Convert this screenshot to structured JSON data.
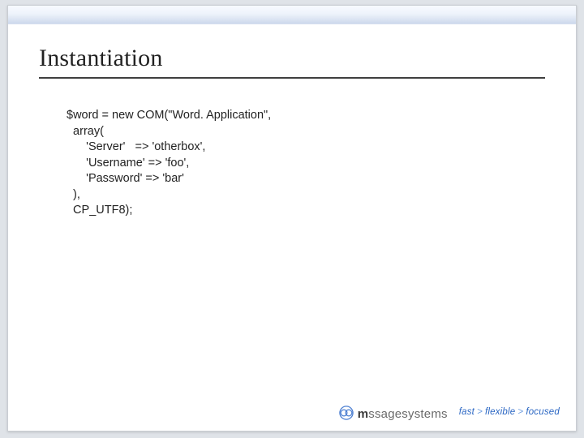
{
  "heading": "Instantiation",
  "code": {
    "l1": "$word = new COM(\"Word. Application\",",
    "l2": "  array(",
    "l3": "      'Server'   => 'otherbox',",
    "l4": "      'Username' => 'foo',",
    "l5": "      'Password' => 'bar'",
    "l6": "  ),",
    "l7": "  CP_UTF8);"
  },
  "brand": {
    "prefix": "m",
    "suffix": "ssagesystems"
  },
  "tagline": {
    "w1": "fast",
    "w2": "flexible",
    "w3": "focused"
  }
}
